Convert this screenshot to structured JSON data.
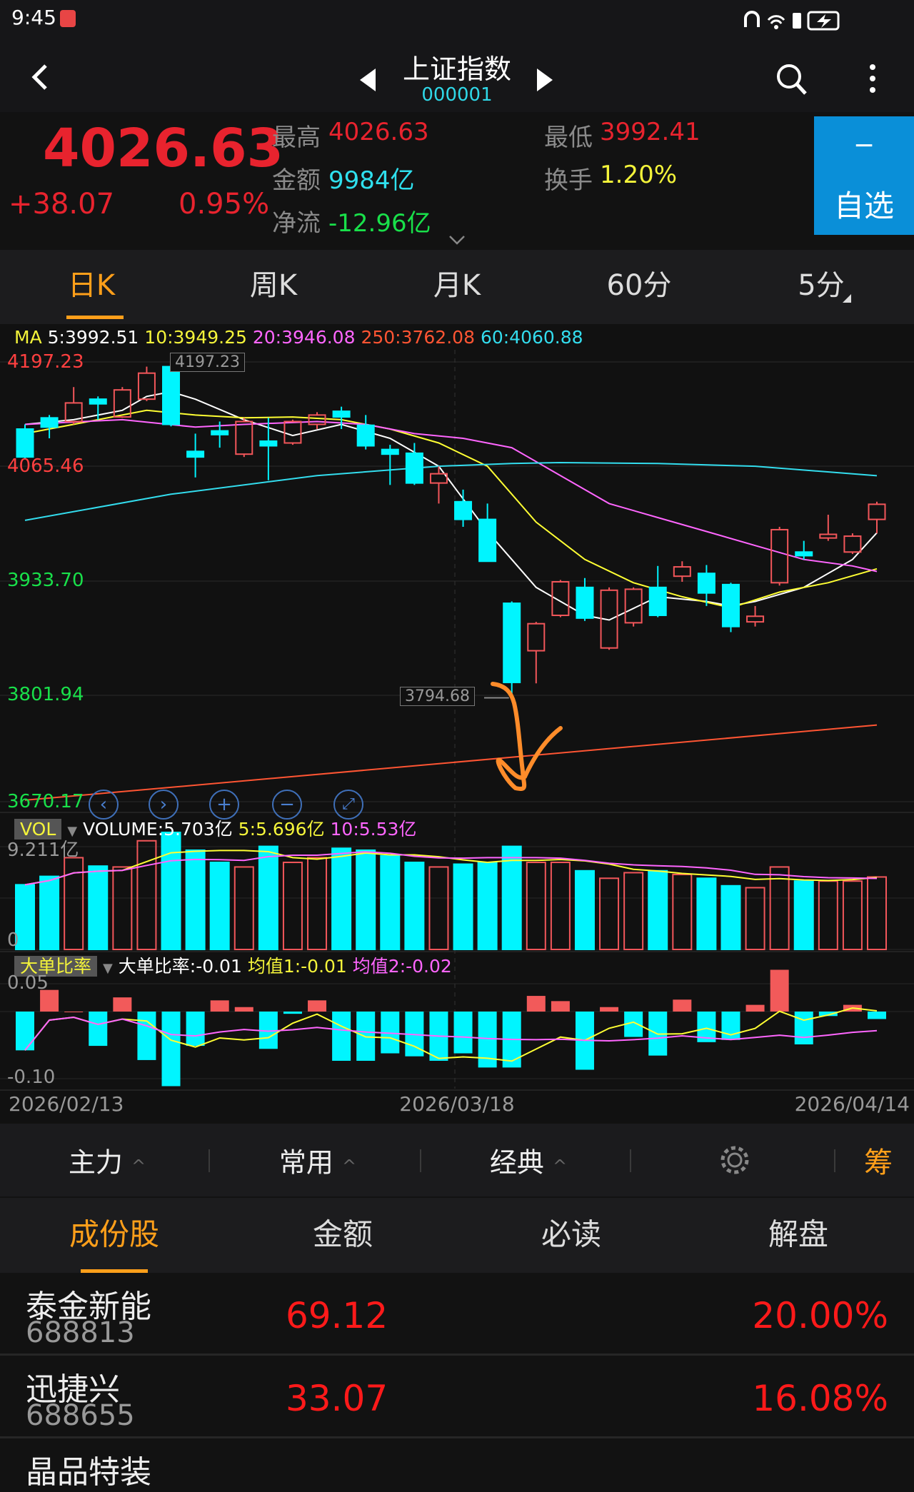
{
  "status_bar": {
    "time": "9:45"
  },
  "nav": {
    "title": "上证指数",
    "code": "000001"
  },
  "quote": {
    "price": "4026.63",
    "change": "+38.07",
    "change_pct": "0.95%",
    "high_label": "最高",
    "high": "4026.63",
    "low_label": "最低",
    "low": "3992.41",
    "amount_label": "金额",
    "amount": "9984亿",
    "turnover_label": "换手",
    "turnover": "1.20%",
    "netflow_label": "净流",
    "netflow": "-12.96亿",
    "watch_button": {
      "sign": "−",
      "label": "自选"
    }
  },
  "periods": [
    {
      "label": "日K",
      "active": true
    },
    {
      "label": "周K"
    },
    {
      "label": "月K"
    },
    {
      "label": "60分"
    },
    {
      "label": "5分"
    }
  ],
  "ma_legend": {
    "prefix": "MA",
    "ma5": "5:3992.51",
    "ma10": "10:3949.25",
    "ma20": "20:3946.08",
    "ma250": "250:3762.08",
    "ma60": "60:4060.88"
  },
  "price_axis": [
    "4197.23",
    "4065.46",
    "3933.70",
    "3801.94",
    "3670.17"
  ],
  "markers": {
    "high": "4197.23",
    "low": "3794.68"
  },
  "vol_legend": {
    "tag": "VOL",
    "volume": "VOLUME:5.703亿",
    "ma5": "5:5.696亿",
    "ma10": "10:5.53亿",
    "max": "9.211亿",
    "zero": "0"
  },
  "ratio_legend": {
    "tag": "大单比率",
    "value": "大单比率:-0.01",
    "avg1": "均值1:-0.01",
    "avg2": "均值2:-0.02",
    "max": "0.05",
    "min": "-0.10"
  },
  "dates": [
    "2026/02/13",
    "2026/03/18",
    "2026/04/14"
  ],
  "toolbar": [
    {
      "label": "主力"
    },
    {
      "label": "常用"
    },
    {
      "label": "经典"
    }
  ],
  "toolbar_right": "筹",
  "bottom_tabs": [
    {
      "label": "成份股",
      "active": true
    },
    {
      "label": "金额"
    },
    {
      "label": "必读"
    },
    {
      "label": "解盘"
    }
  ],
  "stocks": [
    {
      "name": "泰金新能",
      "code": "688813",
      "value": "69.12",
      "pct": "20.00%"
    },
    {
      "name": "迅捷兴",
      "code": "688655",
      "value": "33.07",
      "pct": "16.08%"
    },
    {
      "name": "晶品特装",
      "code": "",
      "value": "",
      "pct": ""
    }
  ],
  "colors": {
    "up": "#f2565a",
    "down": "#00f5ff",
    "ma5": "#ffffff",
    "ma10": "#ffff33",
    "ma20": "#ff66ff",
    "ma60": "#33ddee",
    "ma250": "#ff5533",
    "accent": "#ff9f1a",
    "watch_bg": "#0a8fd8"
  },
  "chart_data": {
    "type": "candlestick",
    "price_range": [
      3670.17,
      4197.23
    ],
    "ohlc": [
      [
        4116.8,
        4122.4,
        4081.1,
        4083.3
      ],
      [
        4130.2,
        4133.6,
        4105.7,
        4119.1
      ],
      [
        4125.8,
        4167.1,
        4122.4,
        4148.1
      ],
      [
        4152.6,
        4155.9,
        4128.0,
        4147.0
      ],
      [
        4131.3,
        4167.1,
        4130.2,
        4163.7
      ],
      [
        4152.6,
        4191.6,
        4150.3,
        4183.8
      ],
      [
        4191.6,
        4197.23,
        4120.0,
        4122.4
      ],
      [
        4090.0,
        4111.3,
        4058.8,
        4083.3
      ],
      [
        4114.6,
        4125.8,
        4094.5,
        4110.1
      ],
      [
        4086.7,
        4130.2,
        4083.3,
        4125.8
      ],
      [
        4102.3,
        4130.2,
        4055.4,
        4096.7
      ],
      [
        4100.1,
        4128.0,
        4097.9,
        4125.8
      ],
      [
        4122.4,
        4137.0,
        4116.8,
        4133.6
      ],
      [
        4138.1,
        4143.6,
        4116.8,
        4131.3
      ],
      [
        4121.3,
        4133.6,
        4092.3,
        4096.7
      ],
      [
        4092.3,
        4097.9,
        4049.8,
        4086.7
      ],
      [
        4087.8,
        4100.1,
        4049.8,
        4052.1
      ],
      [
        4052.1,
        4072.2,
        4027.5,
        4063.2
      ],
      [
        4029.7,
        4044.2,
        3999.6,
        4008.5
      ],
      [
        4008.5,
        4027.5,
        3958.3,
        3958.3
      ],
      [
        3908.0,
        3910.2,
        3794.68,
        3813.1
      ],
      [
        3851.1,
        3885.7,
        3812.0,
        3883.5
      ],
      [
        3893.5,
        3935.9,
        3891.3,
        3933.7
      ],
      [
        3927.0,
        3938.2,
        3886.8,
        3890.2
      ],
      [
        3854.4,
        3927.0,
        3852.2,
        3923.6
      ],
      [
        3884.6,
        3927.0,
        3880.1,
        3924.8
      ],
      [
        3927.0,
        3952.7,
        3891.3,
        3893.5
      ],
      [
        3940.4,
        3958.3,
        3933.7,
        3951.6
      ],
      [
        3943.8,
        3953.8,
        3904.7,
        3920.3
      ],
      [
        3930.4,
        3932.6,
        3873.4,
        3880.1
      ],
      [
        3885.7,
        3904.7,
        3880.1,
        3892.4
      ],
      [
        3932.6,
        3999.6,
        3929.2,
        3996.2
      ],
      [
        3969.4,
        3982.8,
        3960.5,
        3965.0
      ],
      [
        3986.2,
        4014.1,
        3982.8,
        3990.6
      ],
      [
        3969.4,
        3991.8,
        3967.0,
        3988.4
      ],
      [
        4008.5,
        4029.7,
        3991.8,
        4026.63
      ]
    ],
    "ma": {
      "ma5": [
        [
          0,
          4122.4
        ],
        [
          2,
          4128.0
        ],
        [
          4,
          4139.2
        ],
        [
          5,
          4155.9
        ],
        [
          6,
          4161.5
        ],
        [
          7,
          4152.6
        ],
        [
          9,
          4128.0
        ],
        [
          11,
          4109.0
        ],
        [
          13,
          4122.4
        ],
        [
          15,
          4105.7
        ],
        [
          17,
          4072.2
        ],
        [
          19,
          3994.0
        ],
        [
          20,
          3960.5
        ],
        [
          21,
          3927.0
        ],
        [
          23,
          3893.5
        ],
        [
          24,
          3887.9
        ],
        [
          26,
          3915.8
        ],
        [
          28,
          3910.2
        ],
        [
          29,
          3904.7
        ],
        [
          30,
          3910.2
        ],
        [
          32,
          3927.0
        ],
        [
          34,
          3960.5
        ],
        [
          35,
          3992.51
        ]
      ],
      "ma10": [
        [
          0,
          4111.3
        ],
        [
          3,
          4128.0
        ],
        [
          5,
          4139.2
        ],
        [
          7,
          4133.6
        ],
        [
          9,
          4130.2
        ],
        [
          11,
          4131.3
        ],
        [
          13,
          4128.0
        ],
        [
          15,
          4116.8
        ],
        [
          17,
          4100.1
        ],
        [
          19,
          4072.2
        ],
        [
          21,
          4005.2
        ],
        [
          23,
          3960.5
        ],
        [
          25,
          3932.6
        ],
        [
          27,
          3915.8
        ],
        [
          29,
          3902.6
        ],
        [
          31,
          3921.4
        ],
        [
          33,
          3932.6
        ],
        [
          35,
          3949.25
        ]
      ],
      "ma20": [
        [
          0,
          4122.4
        ],
        [
          4,
          4128.0
        ],
        [
          7,
          4119.1
        ],
        [
          9,
          4122.4
        ],
        [
          12,
          4125.8
        ],
        [
          14,
          4122.4
        ],
        [
          16,
          4111.3
        ],
        [
          18,
          4105.7
        ],
        [
          20,
          4094.5
        ],
        [
          22,
          4061.0
        ],
        [
          24,
          4027.5
        ],
        [
          26,
          4010.7
        ],
        [
          28,
          3994.0
        ],
        [
          30,
          3977.2
        ],
        [
          32,
          3960.5
        ],
        [
          34,
          3952.7
        ],
        [
          35,
          3946.08
        ]
      ],
      "ma60": [
        [
          0,
          4007.4
        ],
        [
          6,
          4038.7
        ],
        [
          12,
          4061.0
        ],
        [
          17,
          4072.2
        ],
        [
          20,
          4075.5
        ],
        [
          22,
          4076.6
        ],
        [
          26,
          4075.5
        ],
        [
          30,
          4072.2
        ],
        [
          35,
          4060.88
        ]
      ],
      "ma250": [
        [
          0,
          3672.0
        ],
        [
          35,
          3762.08
        ]
      ]
    },
    "volume_yi": [
      5.09,
      5.75,
      7.22,
      6.56,
      6.49,
      8.55,
      9.21,
      7.81,
      6.85,
      6.49,
      8.11,
      6.85,
      7.22,
      7.96,
      7.81,
      7.37,
      6.85,
      6.49,
      6.71,
      6.85,
      8.11,
      6.85,
      6.85,
      6.19,
      5.6,
      6.04,
      6.19,
      5.9,
      5.6,
      5.01,
      4.86,
      6.49,
      5.38,
      5.38,
      5.38,
      5.703
    ],
    "volume_range": [
      0,
      9.211
    ],
    "big_order_ratio": [
      -0.052,
      0.029,
      0,
      -0.046,
      0.019,
      -0.065,
      -0.1,
      -0.046,
      0.015,
      0.006,
      -0.05,
      -0.003,
      0.015,
      -0.066,
      -0.066,
      -0.056,
      -0.06,
      -0.066,
      -0.056,
      -0.075,
      -0.075,
      0.021,
      0.014,
      -0.078,
      0.006,
      -0.034,
      -0.059,
      0.016,
      -0.041,
      -0.038,
      0.009,
      0.056,
      -0.044,
      -0.006,
      0.009,
      -0.01
    ],
    "ratio_range": [
      -0.1,
      0.05
    ],
    "x_labels": [
      "2026/02/13",
      "2026/03/18",
      "2026/04/14"
    ]
  }
}
